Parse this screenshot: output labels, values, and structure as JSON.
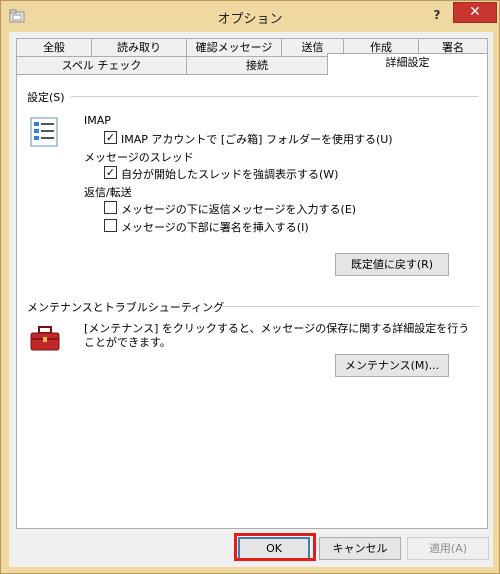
{
  "window": {
    "title": "オプション",
    "help_label": "?",
    "close_label": "✕",
    "accent": "#f0d9a0",
    "close_color": "#c7372f"
  },
  "tabs_row1": [
    {
      "label": "全般"
    },
    {
      "label": "読み取り"
    },
    {
      "label": "確認メッセージ"
    },
    {
      "label": "送信"
    },
    {
      "label": "作成"
    },
    {
      "label": "署名"
    }
  ],
  "tabs_row2": [
    {
      "label": "スペル チェック"
    },
    {
      "label": "接続"
    },
    {
      "label": "詳細設定"
    }
  ],
  "settings": {
    "group_title": "設定(S)",
    "icon": "checklist-icon",
    "imap_label": "IMAP",
    "imap_trash_option": "IMAP アカウントで [ごみ箱] フォルダーを使用する(U)",
    "imap_trash_checked": true,
    "thread_label": "メッセージのスレッド",
    "thread_option": "自分が開始したスレッドを強調表示する(W)",
    "thread_checked": true,
    "reply_label": "返信/転送",
    "reply_below_option": "メッセージの下に返信メッセージを入力する(E)",
    "reply_below_checked": false,
    "sig_below_option": "メッセージの下部に署名を挿入する(I)",
    "sig_below_checked": false,
    "restore_defaults_button": "既定値に戻す(R)"
  },
  "maintenance": {
    "group_title": "メンテナンスとトラブルシューティング",
    "icon": "toolbox-icon",
    "description": "[メンテナンス] をクリックすると、メッセージの保存に関する詳細設定を行うことができます。",
    "maintenance_button": "メンテナンス(M)..."
  },
  "footer": {
    "ok_button": "OK",
    "cancel_button": "キャンセル",
    "apply_button": "適用(A)",
    "highlight_color": "#e21b1b"
  }
}
